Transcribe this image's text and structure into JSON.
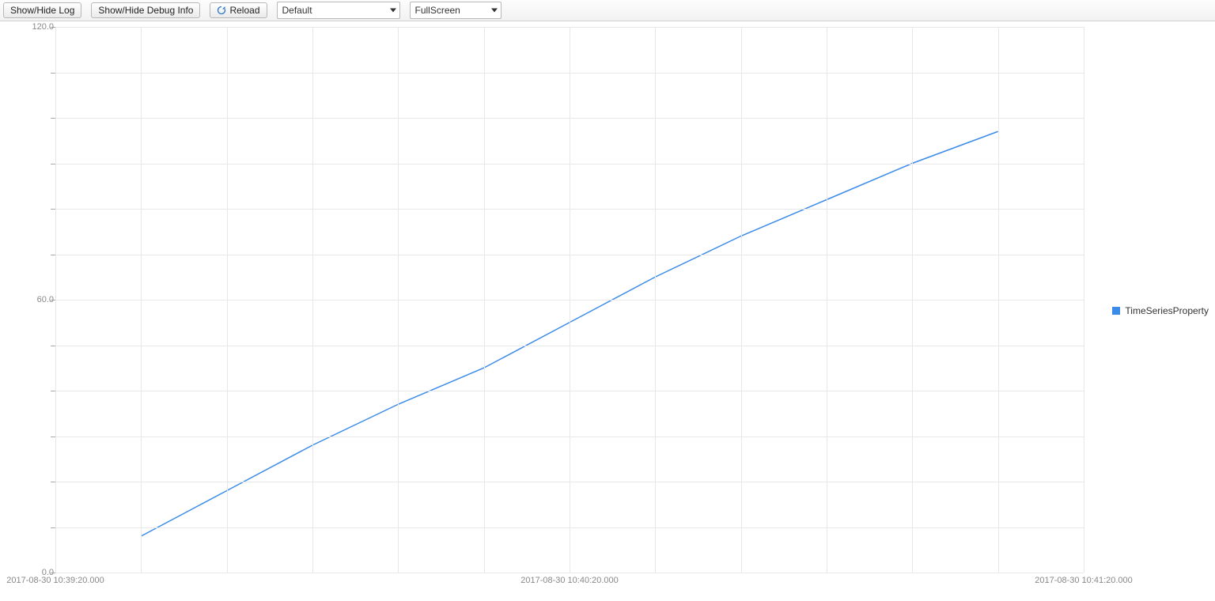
{
  "toolbar": {
    "log_button_label": "Show/Hide Log",
    "debug_button_label": "Show/Hide Debug Info",
    "reload_button_label": "Reload",
    "select1_value": "Default",
    "select2_value": "FullScreen"
  },
  "chart_data": {
    "type": "line",
    "title": "",
    "xlabel": "",
    "ylabel": "",
    "ylim": [
      0,
      120
    ],
    "y_ticks_major": [
      0.0,
      60.0,
      120.0
    ],
    "y_ticks_minor": [
      10,
      20,
      30,
      40,
      50,
      70,
      80,
      90,
      100,
      110
    ],
    "x_tick_labels": [
      "2017-08-30 10:39:20.000",
      "2017-08-30 10:40:20.000",
      "2017-08-30 10:41:20.000"
    ],
    "x_minor_grid_count": 12,
    "series": [
      {
        "name": "TimeSeriesProperty",
        "color": "#3b8be9",
        "x": [
          "2017-08-30 10:39:30",
          "2017-08-30 10:39:40",
          "2017-08-30 10:39:50",
          "2017-08-30 10:40:00",
          "2017-08-30 10:40:10",
          "2017-08-30 10:40:20",
          "2017-08-30 10:40:30",
          "2017-08-30 10:40:40",
          "2017-08-30 10:40:50",
          "2017-08-30 10:41:00",
          "2017-08-30 10:41:10"
        ],
        "values": [
          8,
          18,
          28,
          37,
          45,
          55,
          65,
          74,
          82,
          90,
          97
        ]
      }
    ],
    "legend_label": "TimeSeriesProperty"
  },
  "axis_labels": {
    "y0": "0.0",
    "y60": "60.0",
    "y120": "120.0"
  }
}
